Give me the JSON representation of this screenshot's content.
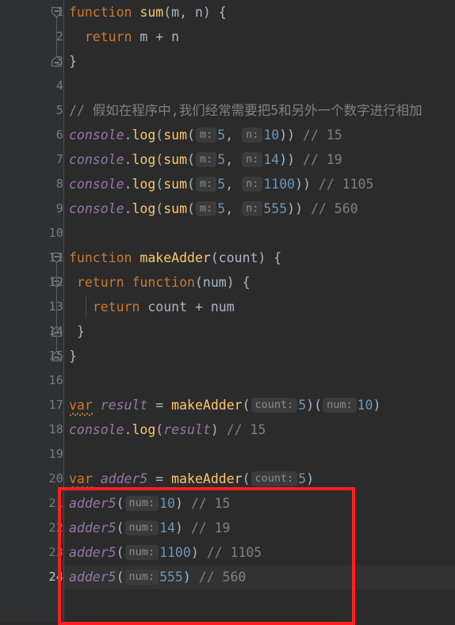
{
  "editor": {
    "app": "code-editor",
    "language": "javascript",
    "current_line": 24,
    "total_visible_lines": 24,
    "colors": {
      "background": "#2b2b2b",
      "gutter_background": "#2f3031",
      "line_number": "#777c80",
      "line_number_current": "#c8cdd2",
      "current_line_highlight": "#323232",
      "keyword": "#cc7832",
      "function_name": "#ffc66d",
      "number": "#6897bb",
      "comment": "#808080",
      "identifier_italic": "#9876aa",
      "default_text": "#a9b7c6",
      "param_hint_bg": "#3b3b3b",
      "param_hint_text": "#888e92",
      "annotation_box": "#ff1f1f",
      "warning_squiggle": "#b8863b"
    }
  },
  "gutter": {
    "line_numbers": [
      "1",
      "2",
      "3",
      "4",
      "5",
      "6",
      "7",
      "8",
      "9",
      "10",
      "11",
      "12",
      "13",
      "14",
      "15",
      "16",
      "17",
      "18",
      "19",
      "20",
      "21",
      "22",
      "23",
      "24"
    ],
    "fold_markers": [
      {
        "line": 1,
        "state": "expanded-open",
        "icon": "fold-collapse-icon"
      },
      {
        "line": 3,
        "state": "expanded-close",
        "icon": "fold-end-icon"
      },
      {
        "line": 11,
        "state": "expanded-open",
        "icon": "fold-collapse-icon"
      },
      {
        "line": 12,
        "state": "expanded-open",
        "icon": "fold-collapse-icon"
      },
      {
        "line": 14,
        "state": "expanded-close",
        "icon": "fold-end-icon"
      },
      {
        "line": 15,
        "state": "expanded-close",
        "icon": "fold-end-icon"
      }
    ]
  },
  "code": {
    "lines": [
      {
        "n": 1,
        "tokens": [
          {
            "t": "kw",
            "v": "function"
          },
          {
            "t": "sp",
            "v": " "
          },
          {
            "t": "fn",
            "v": "sum"
          },
          {
            "t": "par",
            "v": "("
          },
          {
            "t": "loc",
            "v": "m"
          },
          {
            "t": "par",
            "v": ", "
          },
          {
            "t": "loc",
            "v": "n"
          },
          {
            "t": "par",
            "v": ") {"
          }
        ]
      },
      {
        "n": 2,
        "tokens": [
          {
            "t": "sp",
            "v": "  "
          },
          {
            "t": "kw",
            "v": "return"
          },
          {
            "t": "sp",
            "v": " "
          },
          {
            "t": "loc",
            "v": "m"
          },
          {
            "t": "op",
            "v": " + "
          },
          {
            "t": "loc",
            "v": "n"
          }
        ]
      },
      {
        "n": 3,
        "tokens": [
          {
            "t": "par",
            "v": "}"
          }
        ]
      },
      {
        "n": 4,
        "tokens": []
      },
      {
        "n": 5,
        "tokens": [
          {
            "t": "cmt",
            "v": "// 假如在程序中,我们经常需要把5和另外一个数字进行相加"
          }
        ]
      },
      {
        "n": 6,
        "tokens": [
          {
            "t": "obj",
            "v": "console"
          },
          {
            "t": "par",
            "v": "."
          },
          {
            "t": "fn",
            "v": "log"
          },
          {
            "t": "par",
            "v": "("
          },
          {
            "t": "fn",
            "v": "sum"
          },
          {
            "t": "par",
            "v": "("
          },
          {
            "t": "hint",
            "v": "m:"
          },
          {
            "t": "num",
            "v": "5"
          },
          {
            "t": "par",
            "v": ", "
          },
          {
            "t": "hint",
            "v": "n:"
          },
          {
            "t": "num",
            "v": "10"
          },
          {
            "t": "par",
            "v": "))"
          },
          {
            "t": "sp",
            "v": " "
          },
          {
            "t": "cmt",
            "v": "// 15"
          }
        ]
      },
      {
        "n": 7,
        "tokens": [
          {
            "t": "obj",
            "v": "console"
          },
          {
            "t": "par",
            "v": "."
          },
          {
            "t": "fn",
            "v": "log"
          },
          {
            "t": "par",
            "v": "("
          },
          {
            "t": "fn",
            "v": "sum"
          },
          {
            "t": "par",
            "v": "("
          },
          {
            "t": "hint",
            "v": "m:"
          },
          {
            "t": "num",
            "v": "5"
          },
          {
            "t": "par",
            "v": ", "
          },
          {
            "t": "hint",
            "v": "n:"
          },
          {
            "t": "num",
            "v": "14"
          },
          {
            "t": "par",
            "v": "))"
          },
          {
            "t": "sp",
            "v": " "
          },
          {
            "t": "cmt",
            "v": "// 19"
          }
        ]
      },
      {
        "n": 8,
        "tokens": [
          {
            "t": "obj",
            "v": "console"
          },
          {
            "t": "par",
            "v": "."
          },
          {
            "t": "fn",
            "v": "log"
          },
          {
            "t": "par",
            "v": "("
          },
          {
            "t": "fn",
            "v": "sum"
          },
          {
            "t": "par",
            "v": "("
          },
          {
            "t": "hint",
            "v": "m:"
          },
          {
            "t": "num",
            "v": "5"
          },
          {
            "t": "par",
            "v": ", "
          },
          {
            "t": "hint",
            "v": "n:"
          },
          {
            "t": "num",
            "v": "1100"
          },
          {
            "t": "par",
            "v": "))"
          },
          {
            "t": "sp",
            "v": " "
          },
          {
            "t": "cmt",
            "v": "// 1105"
          }
        ]
      },
      {
        "n": 9,
        "tokens": [
          {
            "t": "obj",
            "v": "console"
          },
          {
            "t": "par",
            "v": "."
          },
          {
            "t": "fn",
            "v": "log"
          },
          {
            "t": "par",
            "v": "("
          },
          {
            "t": "fn",
            "v": "sum"
          },
          {
            "t": "par",
            "v": "("
          },
          {
            "t": "hint",
            "v": "m:"
          },
          {
            "t": "num",
            "v": "5"
          },
          {
            "t": "par",
            "v": ", "
          },
          {
            "t": "hint",
            "v": "n:"
          },
          {
            "t": "num",
            "v": "555"
          },
          {
            "t": "par",
            "v": "))"
          },
          {
            "t": "sp",
            "v": " "
          },
          {
            "t": "cmt",
            "v": "// 560"
          }
        ]
      },
      {
        "n": 10,
        "tokens": []
      },
      {
        "n": 11,
        "tokens": [
          {
            "t": "kw",
            "v": "function"
          },
          {
            "t": "sp",
            "v": " "
          },
          {
            "t": "fn",
            "v": "makeAdder"
          },
          {
            "t": "par",
            "v": "("
          },
          {
            "t": "loc",
            "v": "count"
          },
          {
            "t": "par",
            "v": ") {"
          }
        ]
      },
      {
        "n": 12,
        "tokens": [
          {
            "t": "sp",
            "v": " "
          },
          {
            "t": "kw",
            "v": "return"
          },
          {
            "t": "sp",
            "v": " "
          },
          {
            "t": "kw",
            "v": "function"
          },
          {
            "t": "par",
            "v": "("
          },
          {
            "t": "loc",
            "v": "num"
          },
          {
            "t": "par",
            "v": ") {"
          }
        ]
      },
      {
        "n": 13,
        "tokens": [
          {
            "t": "sp",
            "v": "   "
          },
          {
            "t": "kw",
            "v": "return"
          },
          {
            "t": "sp",
            "v": " "
          },
          {
            "t": "loc",
            "v": "count"
          },
          {
            "t": "op",
            "v": " + "
          },
          {
            "t": "loc",
            "v": "num"
          }
        ]
      },
      {
        "n": 14,
        "tokens": [
          {
            "t": "sp",
            "v": " "
          },
          {
            "t": "par",
            "v": "}"
          }
        ]
      },
      {
        "n": 15,
        "tokens": [
          {
            "t": "par",
            "v": "}"
          }
        ]
      },
      {
        "n": 16,
        "tokens": []
      },
      {
        "n": 17,
        "tokens": [
          {
            "t": "kwwavy",
            "v": "var"
          },
          {
            "t": "sp",
            "v": " "
          },
          {
            "t": "obj",
            "v": "result"
          },
          {
            "t": "op",
            "v": " = "
          },
          {
            "t": "fn",
            "v": "makeAdder"
          },
          {
            "t": "par",
            "v": "("
          },
          {
            "t": "hint",
            "v": "count:"
          },
          {
            "t": "num",
            "v": "5"
          },
          {
            "t": "par",
            "v": ")("
          },
          {
            "t": "hint",
            "v": "num:"
          },
          {
            "t": "num",
            "v": "10"
          },
          {
            "t": "par",
            "v": ")"
          }
        ]
      },
      {
        "n": 18,
        "tokens": [
          {
            "t": "obj",
            "v": "console"
          },
          {
            "t": "par",
            "v": "."
          },
          {
            "t": "fn",
            "v": "log"
          },
          {
            "t": "par",
            "v": "("
          },
          {
            "t": "obj",
            "v": "result"
          },
          {
            "t": "par",
            "v": ")"
          },
          {
            "t": "sp",
            "v": " "
          },
          {
            "t": "cmt",
            "v": "// 15"
          }
        ]
      },
      {
        "n": 19,
        "tokens": []
      },
      {
        "n": 20,
        "tokens": [
          {
            "t": "kwwavy",
            "v": "var"
          },
          {
            "t": "sp",
            "v": " "
          },
          {
            "t": "obj",
            "v": "adder5"
          },
          {
            "t": "op",
            "v": " = "
          },
          {
            "t": "fn",
            "v": "makeAdder"
          },
          {
            "t": "par",
            "v": "("
          },
          {
            "t": "hint",
            "v": "count:"
          },
          {
            "t": "num",
            "v": "5"
          },
          {
            "t": "par",
            "v": ")"
          }
        ]
      },
      {
        "n": 21,
        "tokens": [
          {
            "t": "obj",
            "v": "adder5"
          },
          {
            "t": "par",
            "v": "("
          },
          {
            "t": "hint",
            "v": "num:"
          },
          {
            "t": "num",
            "v": "10"
          },
          {
            "t": "par",
            "v": ")"
          },
          {
            "t": "sp",
            "v": " "
          },
          {
            "t": "cmt",
            "v": "// 15"
          }
        ]
      },
      {
        "n": 22,
        "tokens": [
          {
            "t": "obj",
            "v": "adder5"
          },
          {
            "t": "par",
            "v": "("
          },
          {
            "t": "hint",
            "v": "num:"
          },
          {
            "t": "num",
            "v": "14"
          },
          {
            "t": "par",
            "v": ")"
          },
          {
            "t": "sp",
            "v": " "
          },
          {
            "t": "cmt",
            "v": "// 19"
          }
        ]
      },
      {
        "n": 23,
        "tokens": [
          {
            "t": "obj",
            "v": "adder5"
          },
          {
            "t": "par",
            "v": "("
          },
          {
            "t": "hint",
            "v": "num:"
          },
          {
            "t": "num",
            "v": "1100"
          },
          {
            "t": "par",
            "v": ")"
          },
          {
            "t": "sp",
            "v": " "
          },
          {
            "t": "cmt",
            "v": "// 1105"
          }
        ]
      },
      {
        "n": 24,
        "tokens": [
          {
            "t": "obj",
            "v": "adder5"
          },
          {
            "t": "par",
            "v": "("
          },
          {
            "t": "hint",
            "v": "num:"
          },
          {
            "t": "num",
            "v": "555"
          },
          {
            "t": "par",
            "v": ")"
          },
          {
            "t": "sp",
            "v": " "
          },
          {
            "t": "cmt",
            "v": "// 560"
          }
        ]
      }
    ]
  },
  "annotation": {
    "type": "red-rectangle-highlight",
    "covers_lines": "20-24",
    "color": "#ff1f1f"
  }
}
